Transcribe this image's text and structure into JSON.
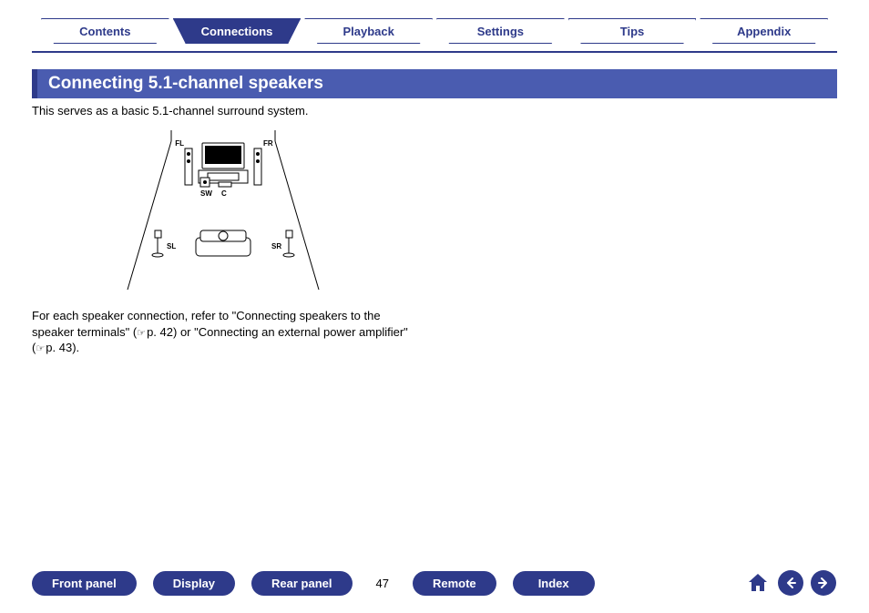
{
  "nav": {
    "tabs": [
      {
        "label": "Contents",
        "active": false
      },
      {
        "label": "Connections",
        "active": true
      },
      {
        "label": "Playback",
        "active": false
      },
      {
        "label": "Settings",
        "active": false
      },
      {
        "label": "Tips",
        "active": false
      },
      {
        "label": "Appendix",
        "active": false
      }
    ]
  },
  "section": {
    "heading": "Connecting 5.1-channel speakers",
    "intro": "This serves as a basic 5.1-channel surround system."
  },
  "diagram": {
    "labels": {
      "fl": "FL",
      "fr": "FR",
      "sw": "SW",
      "c": "C",
      "sl": "SL",
      "sr": "SR"
    }
  },
  "body": {
    "text_part1": "For each speaker connection, refer to \"Connecting speakers to the speaker terminals\" (",
    "ref1": "p. 42",
    "text_part2": ") or \"Connecting an external power amplifier\" (",
    "ref2": "p. 43",
    "text_part3": ")."
  },
  "footer": {
    "buttons": {
      "front_panel": "Front panel",
      "display": "Display",
      "rear_panel": "Rear panel",
      "remote": "Remote",
      "index": "Index"
    },
    "page_number": "47"
  }
}
